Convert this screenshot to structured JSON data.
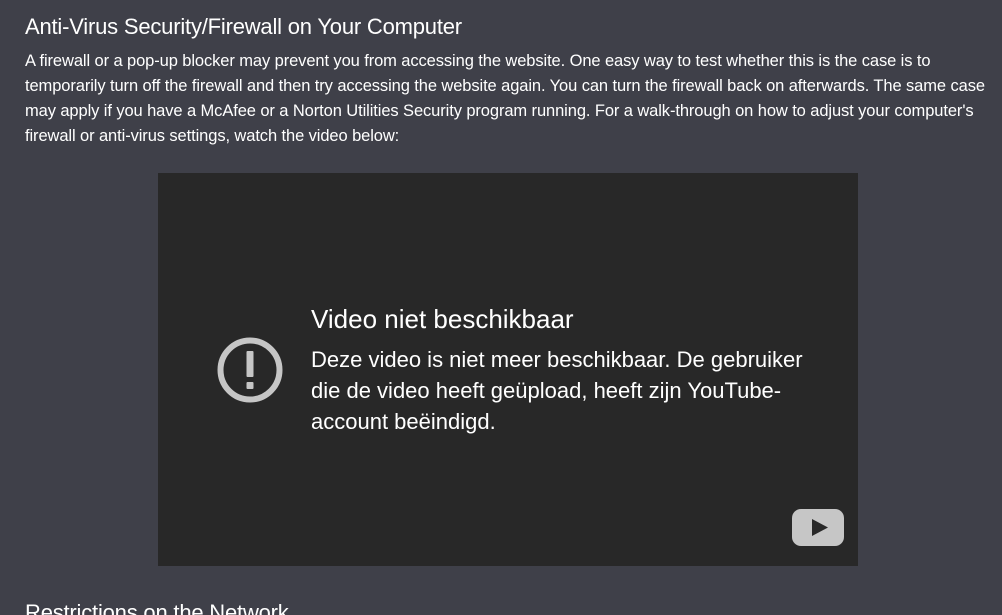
{
  "section": {
    "title": "Anti-Virus Security/Firewall on Your Computer",
    "body": "A firewall or a pop-up blocker may prevent you from accessing the website. One easy way to test whether this is the case is to temporarily turn off the firewall and then try accessing the website again. You can turn the firewall back on afterwards. The same case may apply if you have a McAfee or a Norton Utilities Security program running. For a walk-through on how to adjust your computer's firewall or anti-virus settings, watch the video below:"
  },
  "video": {
    "error_title": "Video niet beschikbaar",
    "error_message": "Deze video is niet meer beschikbaar. De gebruiker die de video heeft geüpload, heeft zijn YouTube-account beëindigd.",
    "icons": {
      "error": "exclamation-circle-icon",
      "logo": "youtube-logo-icon"
    },
    "colors": {
      "background": "#282828",
      "icon": "#c6c6c6"
    }
  },
  "next_section": {
    "title": "Restrictions on the Network"
  },
  "colors": {
    "page_background": "#3f4049",
    "text": "#ffffff"
  }
}
